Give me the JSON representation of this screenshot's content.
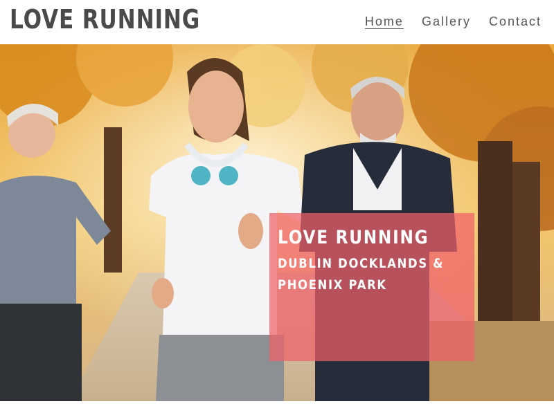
{
  "header": {
    "brand": "LOVE RUNNING",
    "nav": [
      {
        "label": "Home",
        "active": true
      },
      {
        "label": "Gallery",
        "active": false
      },
      {
        "label": "Contact",
        "active": false
      }
    ]
  },
  "hero": {
    "image_description_icon": "runners-photo-icon",
    "caption": {
      "title": "LOVE RUNNING",
      "subtitle_line1": "DUBLIN DOCKLANDS &",
      "subtitle_line2": "PHOENIX PARK"
    }
  },
  "colors": {
    "brand_text": "#4a4a4a",
    "nav_text": "#555555",
    "caption_overlay": "#f06068"
  }
}
